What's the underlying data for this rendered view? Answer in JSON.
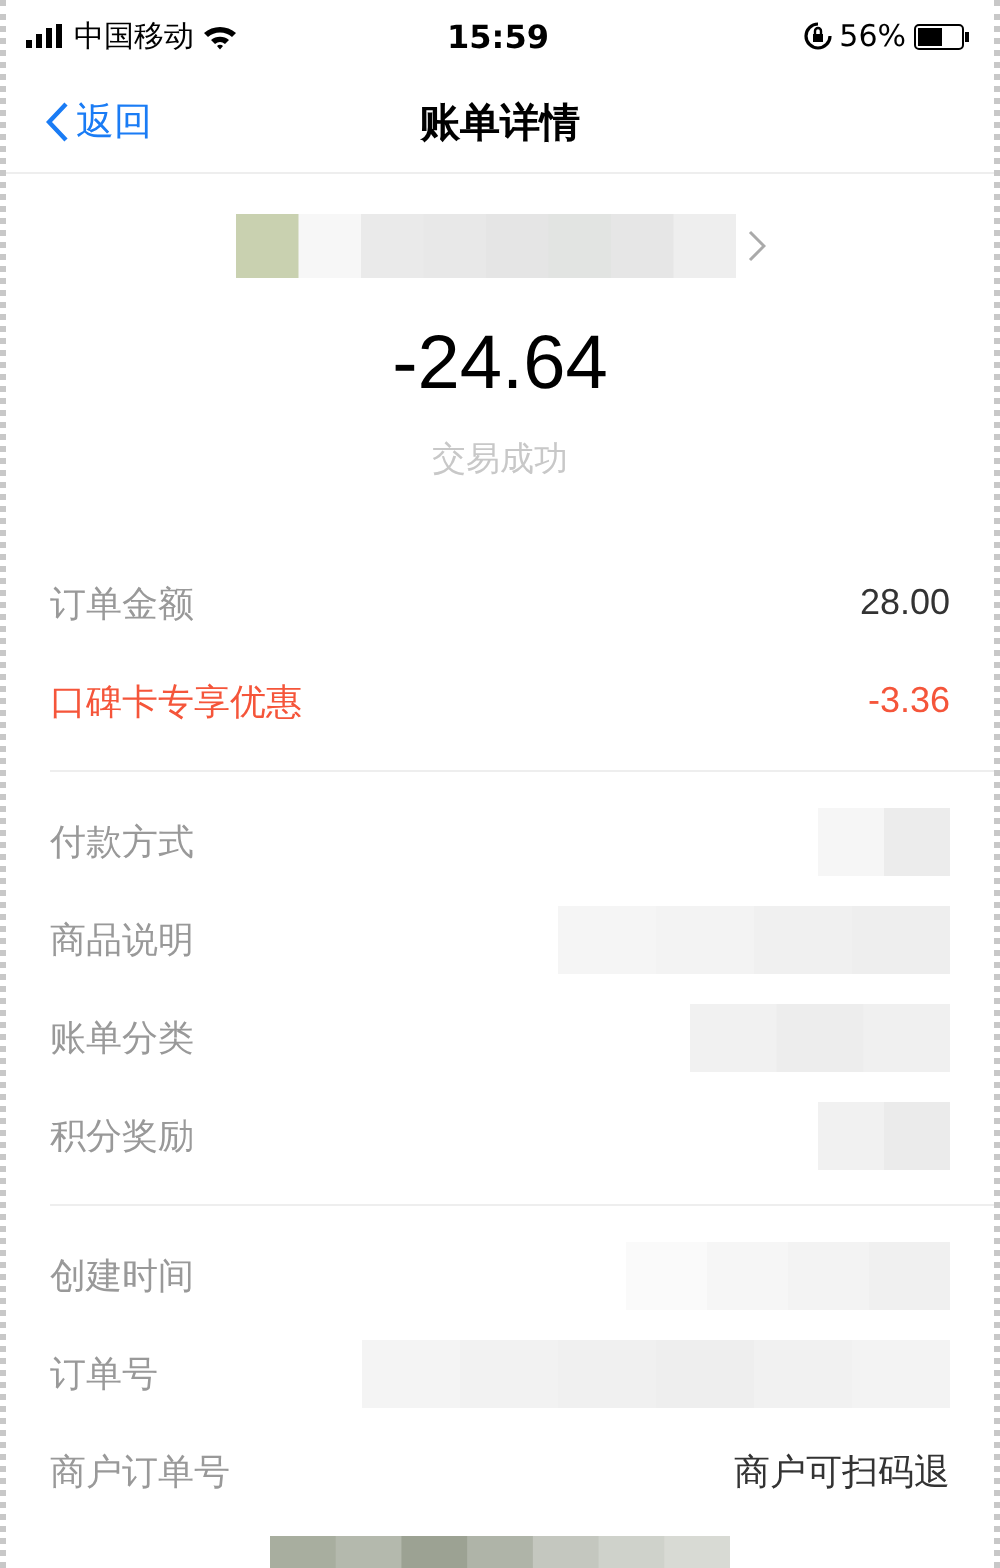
{
  "status_bar": {
    "carrier": "中国移动",
    "time": "15:59",
    "battery": "56%"
  },
  "nav": {
    "back": "返回",
    "title": "账单详情"
  },
  "summary": {
    "amount": "-24.64",
    "status": "交易成功"
  },
  "sections": [
    {
      "rows": [
        {
          "kind": "amount",
          "label": "订单金额",
          "value": "28.00"
        },
        {
          "kind": "discount",
          "label": "口碑卡专享优惠",
          "value": "-3.36"
        }
      ]
    },
    {
      "rows": [
        {
          "kind": "redacted",
          "label": "付款方式"
        },
        {
          "kind": "redacted",
          "label": "商品说明"
        },
        {
          "kind": "redacted",
          "label": "账单分类"
        },
        {
          "kind": "redacted",
          "label": "积分奖励"
        }
      ]
    },
    {
      "rows": [
        {
          "kind": "redacted",
          "label": "创建时间"
        },
        {
          "kind": "redacted",
          "label": "订单号"
        },
        {
          "kind": "amount",
          "label": "商户订单号",
          "value": "商户可扫码退"
        }
      ]
    }
  ]
}
